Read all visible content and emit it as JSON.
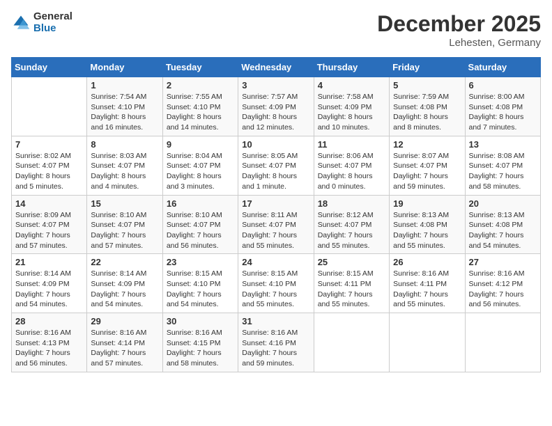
{
  "header": {
    "logo_general": "General",
    "logo_blue": "Blue",
    "month_title": "December 2025",
    "location": "Lehesten, Germany"
  },
  "days_of_week": [
    "Sunday",
    "Monday",
    "Tuesday",
    "Wednesday",
    "Thursday",
    "Friday",
    "Saturday"
  ],
  "weeks": [
    [
      {
        "day": "",
        "sunrise": "",
        "sunset": "",
        "daylight": ""
      },
      {
        "day": "1",
        "sunrise": "Sunrise: 7:54 AM",
        "sunset": "Sunset: 4:10 PM",
        "daylight": "Daylight: 8 hours and 16 minutes."
      },
      {
        "day": "2",
        "sunrise": "Sunrise: 7:55 AM",
        "sunset": "Sunset: 4:10 PM",
        "daylight": "Daylight: 8 hours and 14 minutes."
      },
      {
        "day": "3",
        "sunrise": "Sunrise: 7:57 AM",
        "sunset": "Sunset: 4:09 PM",
        "daylight": "Daylight: 8 hours and 12 minutes."
      },
      {
        "day": "4",
        "sunrise": "Sunrise: 7:58 AM",
        "sunset": "Sunset: 4:09 PM",
        "daylight": "Daylight: 8 hours and 10 minutes."
      },
      {
        "day": "5",
        "sunrise": "Sunrise: 7:59 AM",
        "sunset": "Sunset: 4:08 PM",
        "daylight": "Daylight: 8 hours and 8 minutes."
      },
      {
        "day": "6",
        "sunrise": "Sunrise: 8:00 AM",
        "sunset": "Sunset: 4:08 PM",
        "daylight": "Daylight: 8 hours and 7 minutes."
      }
    ],
    [
      {
        "day": "7",
        "sunrise": "Sunrise: 8:02 AM",
        "sunset": "Sunset: 4:07 PM",
        "daylight": "Daylight: 8 hours and 5 minutes."
      },
      {
        "day": "8",
        "sunrise": "Sunrise: 8:03 AM",
        "sunset": "Sunset: 4:07 PM",
        "daylight": "Daylight: 8 hours and 4 minutes."
      },
      {
        "day": "9",
        "sunrise": "Sunrise: 8:04 AM",
        "sunset": "Sunset: 4:07 PM",
        "daylight": "Daylight: 8 hours and 3 minutes."
      },
      {
        "day": "10",
        "sunrise": "Sunrise: 8:05 AM",
        "sunset": "Sunset: 4:07 PM",
        "daylight": "Daylight: 8 hours and 1 minute."
      },
      {
        "day": "11",
        "sunrise": "Sunrise: 8:06 AM",
        "sunset": "Sunset: 4:07 PM",
        "daylight": "Daylight: 8 hours and 0 minutes."
      },
      {
        "day": "12",
        "sunrise": "Sunrise: 8:07 AM",
        "sunset": "Sunset: 4:07 PM",
        "daylight": "Daylight: 7 hours and 59 minutes."
      },
      {
        "day": "13",
        "sunrise": "Sunrise: 8:08 AM",
        "sunset": "Sunset: 4:07 PM",
        "daylight": "Daylight: 7 hours and 58 minutes."
      }
    ],
    [
      {
        "day": "14",
        "sunrise": "Sunrise: 8:09 AM",
        "sunset": "Sunset: 4:07 PM",
        "daylight": "Daylight: 7 hours and 57 minutes."
      },
      {
        "day": "15",
        "sunrise": "Sunrise: 8:10 AM",
        "sunset": "Sunset: 4:07 PM",
        "daylight": "Daylight: 7 hours and 57 minutes."
      },
      {
        "day": "16",
        "sunrise": "Sunrise: 8:10 AM",
        "sunset": "Sunset: 4:07 PM",
        "daylight": "Daylight: 7 hours and 56 minutes."
      },
      {
        "day": "17",
        "sunrise": "Sunrise: 8:11 AM",
        "sunset": "Sunset: 4:07 PM",
        "daylight": "Daylight: 7 hours and 55 minutes."
      },
      {
        "day": "18",
        "sunrise": "Sunrise: 8:12 AM",
        "sunset": "Sunset: 4:07 PM",
        "daylight": "Daylight: 7 hours and 55 minutes."
      },
      {
        "day": "19",
        "sunrise": "Sunrise: 8:13 AM",
        "sunset": "Sunset: 4:08 PM",
        "daylight": "Daylight: 7 hours and 55 minutes."
      },
      {
        "day": "20",
        "sunrise": "Sunrise: 8:13 AM",
        "sunset": "Sunset: 4:08 PM",
        "daylight": "Daylight: 7 hours and 54 minutes."
      }
    ],
    [
      {
        "day": "21",
        "sunrise": "Sunrise: 8:14 AM",
        "sunset": "Sunset: 4:09 PM",
        "daylight": "Daylight: 7 hours and 54 minutes."
      },
      {
        "day": "22",
        "sunrise": "Sunrise: 8:14 AM",
        "sunset": "Sunset: 4:09 PM",
        "daylight": "Daylight: 7 hours and 54 minutes."
      },
      {
        "day": "23",
        "sunrise": "Sunrise: 8:15 AM",
        "sunset": "Sunset: 4:10 PM",
        "daylight": "Daylight: 7 hours and 54 minutes."
      },
      {
        "day": "24",
        "sunrise": "Sunrise: 8:15 AM",
        "sunset": "Sunset: 4:10 PM",
        "daylight": "Daylight: 7 hours and 55 minutes."
      },
      {
        "day": "25",
        "sunrise": "Sunrise: 8:15 AM",
        "sunset": "Sunset: 4:11 PM",
        "daylight": "Daylight: 7 hours and 55 minutes."
      },
      {
        "day": "26",
        "sunrise": "Sunrise: 8:16 AM",
        "sunset": "Sunset: 4:11 PM",
        "daylight": "Daylight: 7 hours and 55 minutes."
      },
      {
        "day": "27",
        "sunrise": "Sunrise: 8:16 AM",
        "sunset": "Sunset: 4:12 PM",
        "daylight": "Daylight: 7 hours and 56 minutes."
      }
    ],
    [
      {
        "day": "28",
        "sunrise": "Sunrise: 8:16 AM",
        "sunset": "Sunset: 4:13 PM",
        "daylight": "Daylight: 7 hours and 56 minutes."
      },
      {
        "day": "29",
        "sunrise": "Sunrise: 8:16 AM",
        "sunset": "Sunset: 4:14 PM",
        "daylight": "Daylight: 7 hours and 57 minutes."
      },
      {
        "day": "30",
        "sunrise": "Sunrise: 8:16 AM",
        "sunset": "Sunset: 4:15 PM",
        "daylight": "Daylight: 7 hours and 58 minutes."
      },
      {
        "day": "31",
        "sunrise": "Sunrise: 8:16 AM",
        "sunset": "Sunset: 4:16 PM",
        "daylight": "Daylight: 7 hours and 59 minutes."
      },
      {
        "day": "",
        "sunrise": "",
        "sunset": "",
        "daylight": ""
      },
      {
        "day": "",
        "sunrise": "",
        "sunset": "",
        "daylight": ""
      },
      {
        "day": "",
        "sunrise": "",
        "sunset": "",
        "daylight": ""
      }
    ]
  ]
}
